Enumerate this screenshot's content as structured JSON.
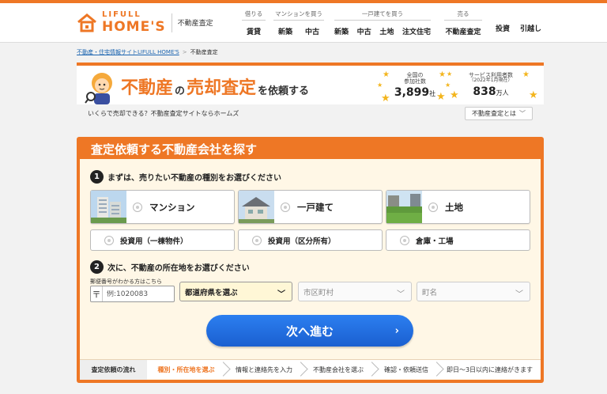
{
  "header": {
    "logo_top": "LIFULL",
    "logo_main": "HOME'S",
    "logo_sub": "不動産査定",
    "nav": [
      {
        "caption": "借りる",
        "items": [
          "賃貸"
        ]
      },
      {
        "caption": "マンションを買う",
        "items": [
          "新築",
          "中古"
        ]
      },
      {
        "caption": "一戸建てを買う",
        "items": [
          "新築",
          "中古",
          "土地",
          "注文住宅"
        ]
      },
      {
        "caption": "売る",
        "items": [
          "不動産査定"
        ]
      },
      {
        "caption": "",
        "items": [
          "投資",
          "引越し"
        ]
      }
    ]
  },
  "breadcrumb": {
    "link": "不動産・住宅情報サイトLIFULL HOME'S",
    "separator": ">",
    "current": "不動産査定"
  },
  "banner": {
    "title_a": "不動産",
    "title_b": "の",
    "title_c": "売却査定",
    "title_d": "を依頼する",
    "stat1_label": "全国の",
    "stat1_label2": "参加社数",
    "stat1_value": "3,899",
    "stat1_unit": "社",
    "stat2_label": "サービス利用者数",
    "stat2_label2": "（2022年1月現在）",
    "stat2_value": "838",
    "stat2_unit": "万人",
    "tagline": "いくらで売却できる？不動産査定サイトならホームズ",
    "about_button": "不動産査定とは",
    "about_chevron": "﹀"
  },
  "form": {
    "title": "査定依頼する不動産会社を探す",
    "step1_num": "1",
    "step1_text": "まずは、売りたい不動産の種別をお選びください",
    "types": [
      "マンション",
      "一戸建て",
      "土地"
    ],
    "types_secondary": [
      "投資用（一棟物件）",
      "投資用（区分所有）",
      "倉庫・工場"
    ],
    "step2_num": "2",
    "step2_text": "次に、不動産の所在地をお選びください",
    "zip_caption": "郵便番号がわかる方はこちら",
    "zip_mark": "〒",
    "zip_placeholder": "例:1020083",
    "prefecture": "都道府県を選ぶ",
    "city": "市区町村",
    "town": "町名",
    "select_chevron": "﹀",
    "next_button": "次へ進む",
    "next_arrow": "›"
  },
  "flow": {
    "label": "査定依頼の流れ",
    "steps": [
      "種別・所在地を選ぶ",
      "情報と連絡先を入力",
      "不動産会社を選ぶ",
      "確認・依頼送信",
      "即日〜3日以内に連絡がきます"
    ]
  },
  "colors": {
    "brand": "#ee7725",
    "button": "#1a5fd0",
    "star": "#f3b51d"
  },
  "icons": [
    "house-logo-icon",
    "mascot-icon",
    "star-icon",
    "radio-icon",
    "chevron-down-icon",
    "postal-mark-icon",
    "arrow-right-icon"
  ]
}
